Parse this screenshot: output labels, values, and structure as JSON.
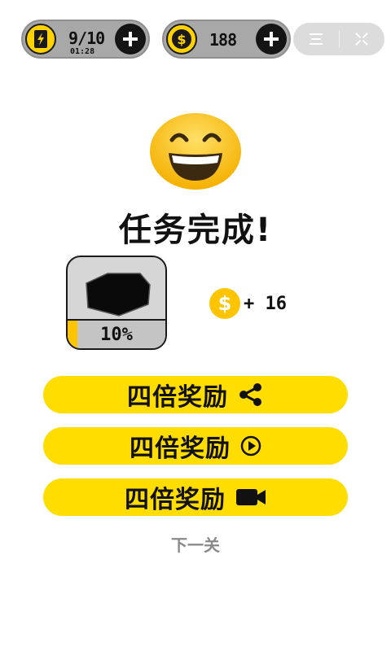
{
  "topbar": {
    "energy": {
      "value": "9/10",
      "timer": "01:28",
      "icon": "lightning-card-icon"
    },
    "coins": {
      "value": "188",
      "icon": "dollar-coin-icon"
    },
    "menu_icon": "menu-icon",
    "close_icon": "close-icon"
  },
  "result": {
    "emoji_icon": "grinning-face-emoji",
    "title": "任务完成!"
  },
  "progress_card": {
    "percent_label": "10%",
    "progress": 0.1,
    "icon": "dark-shape-icon"
  },
  "reward": {
    "coin_icon": "dollar-coin-icon",
    "amount_label": "+ 16"
  },
  "buttons": [
    {
      "label": "四倍奖励",
      "icon": "share-icon"
    },
    {
      "label": "四倍奖励",
      "icon": "play-circle-icon"
    },
    {
      "label": "四倍奖励",
      "icon": "video-camera-icon"
    }
  ],
  "next_label": "下一关",
  "colors": {
    "accent": "#ffdd00",
    "coin": "#ffc400",
    "pill": "#a8a8a8"
  }
}
